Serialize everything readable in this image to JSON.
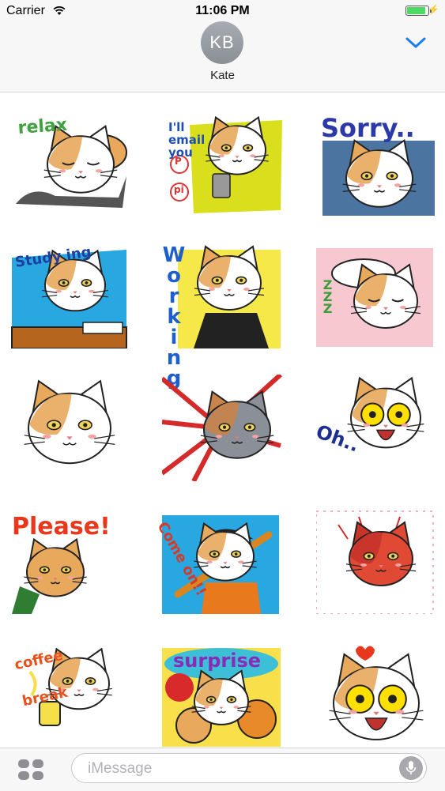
{
  "status_bar": {
    "carrier": "Carrier",
    "time": "11:06 PM",
    "battery_level": 0.9
  },
  "header": {
    "avatar_initials": "KB",
    "contact_name": "Kate"
  },
  "stickers": [
    {
      "caption": "relax",
      "icon": "cat-sleeping-sticker"
    },
    {
      "caption": "I'll email you",
      "icon": "cat-phone-sticker",
      "extra": [
        "P",
        "pi"
      ]
    },
    {
      "caption": "Sorry..",
      "icon": "cat-sorry-sticker"
    },
    {
      "caption": "Study ing",
      "icon": "cat-studying-sticker"
    },
    {
      "caption": "Working",
      "icon": "cat-working-sticker"
    },
    {
      "caption": "ZZZ",
      "icon": "cat-zzz-sticker"
    },
    {
      "caption": "",
      "icon": "cat-crying-sticker"
    },
    {
      "caption": "",
      "icon": "cat-shocked-sticker"
    },
    {
      "caption": "Oh..",
      "icon": "cat-oh-sticker"
    },
    {
      "caption": "Please!",
      "icon": "cat-please-sticker"
    },
    {
      "caption": "Come on!!",
      "icon": "cat-baseball-sticker"
    },
    {
      "caption": "",
      "icon": "cat-angry-hearts-sticker"
    },
    {
      "caption": "coffee break",
      "icon": "cat-coffee-sticker"
    },
    {
      "caption": "surprise",
      "icon": "cat-surprise-sticker"
    },
    {
      "caption": "",
      "icon": "cat-big-eyes-sticker"
    }
  ],
  "composer": {
    "placeholder": "iMessage"
  },
  "colors": {
    "accent": "#1a7ef3",
    "battery": "#4cd964",
    "cat_orange": "#e8a95c"
  }
}
